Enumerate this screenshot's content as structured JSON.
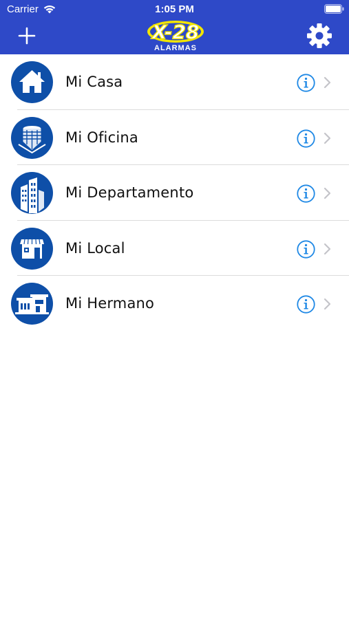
{
  "status_bar": {
    "carrier": "Carrier",
    "time": "1:05 PM"
  },
  "nav": {
    "add_icon": "plus-icon",
    "settings_icon": "gear-icon",
    "logo_text": "X-28",
    "logo_subtext": "ALARMAS"
  },
  "colors": {
    "header_bg": "#2E49C8",
    "icon_blue": "#0E4FA8",
    "info_blue": "#1E88E5",
    "logo_yellow": "#F2E500"
  },
  "locations": [
    {
      "label": "Mi Casa",
      "icon": "house-icon"
    },
    {
      "label": "Mi Oficina",
      "icon": "office-building-icon"
    },
    {
      "label": "Mi Departamento",
      "icon": "apartment-building-icon"
    },
    {
      "label": "Mi Local",
      "icon": "store-icon"
    },
    {
      "label": "Mi Hermano",
      "icon": "modern-house-icon"
    }
  ]
}
